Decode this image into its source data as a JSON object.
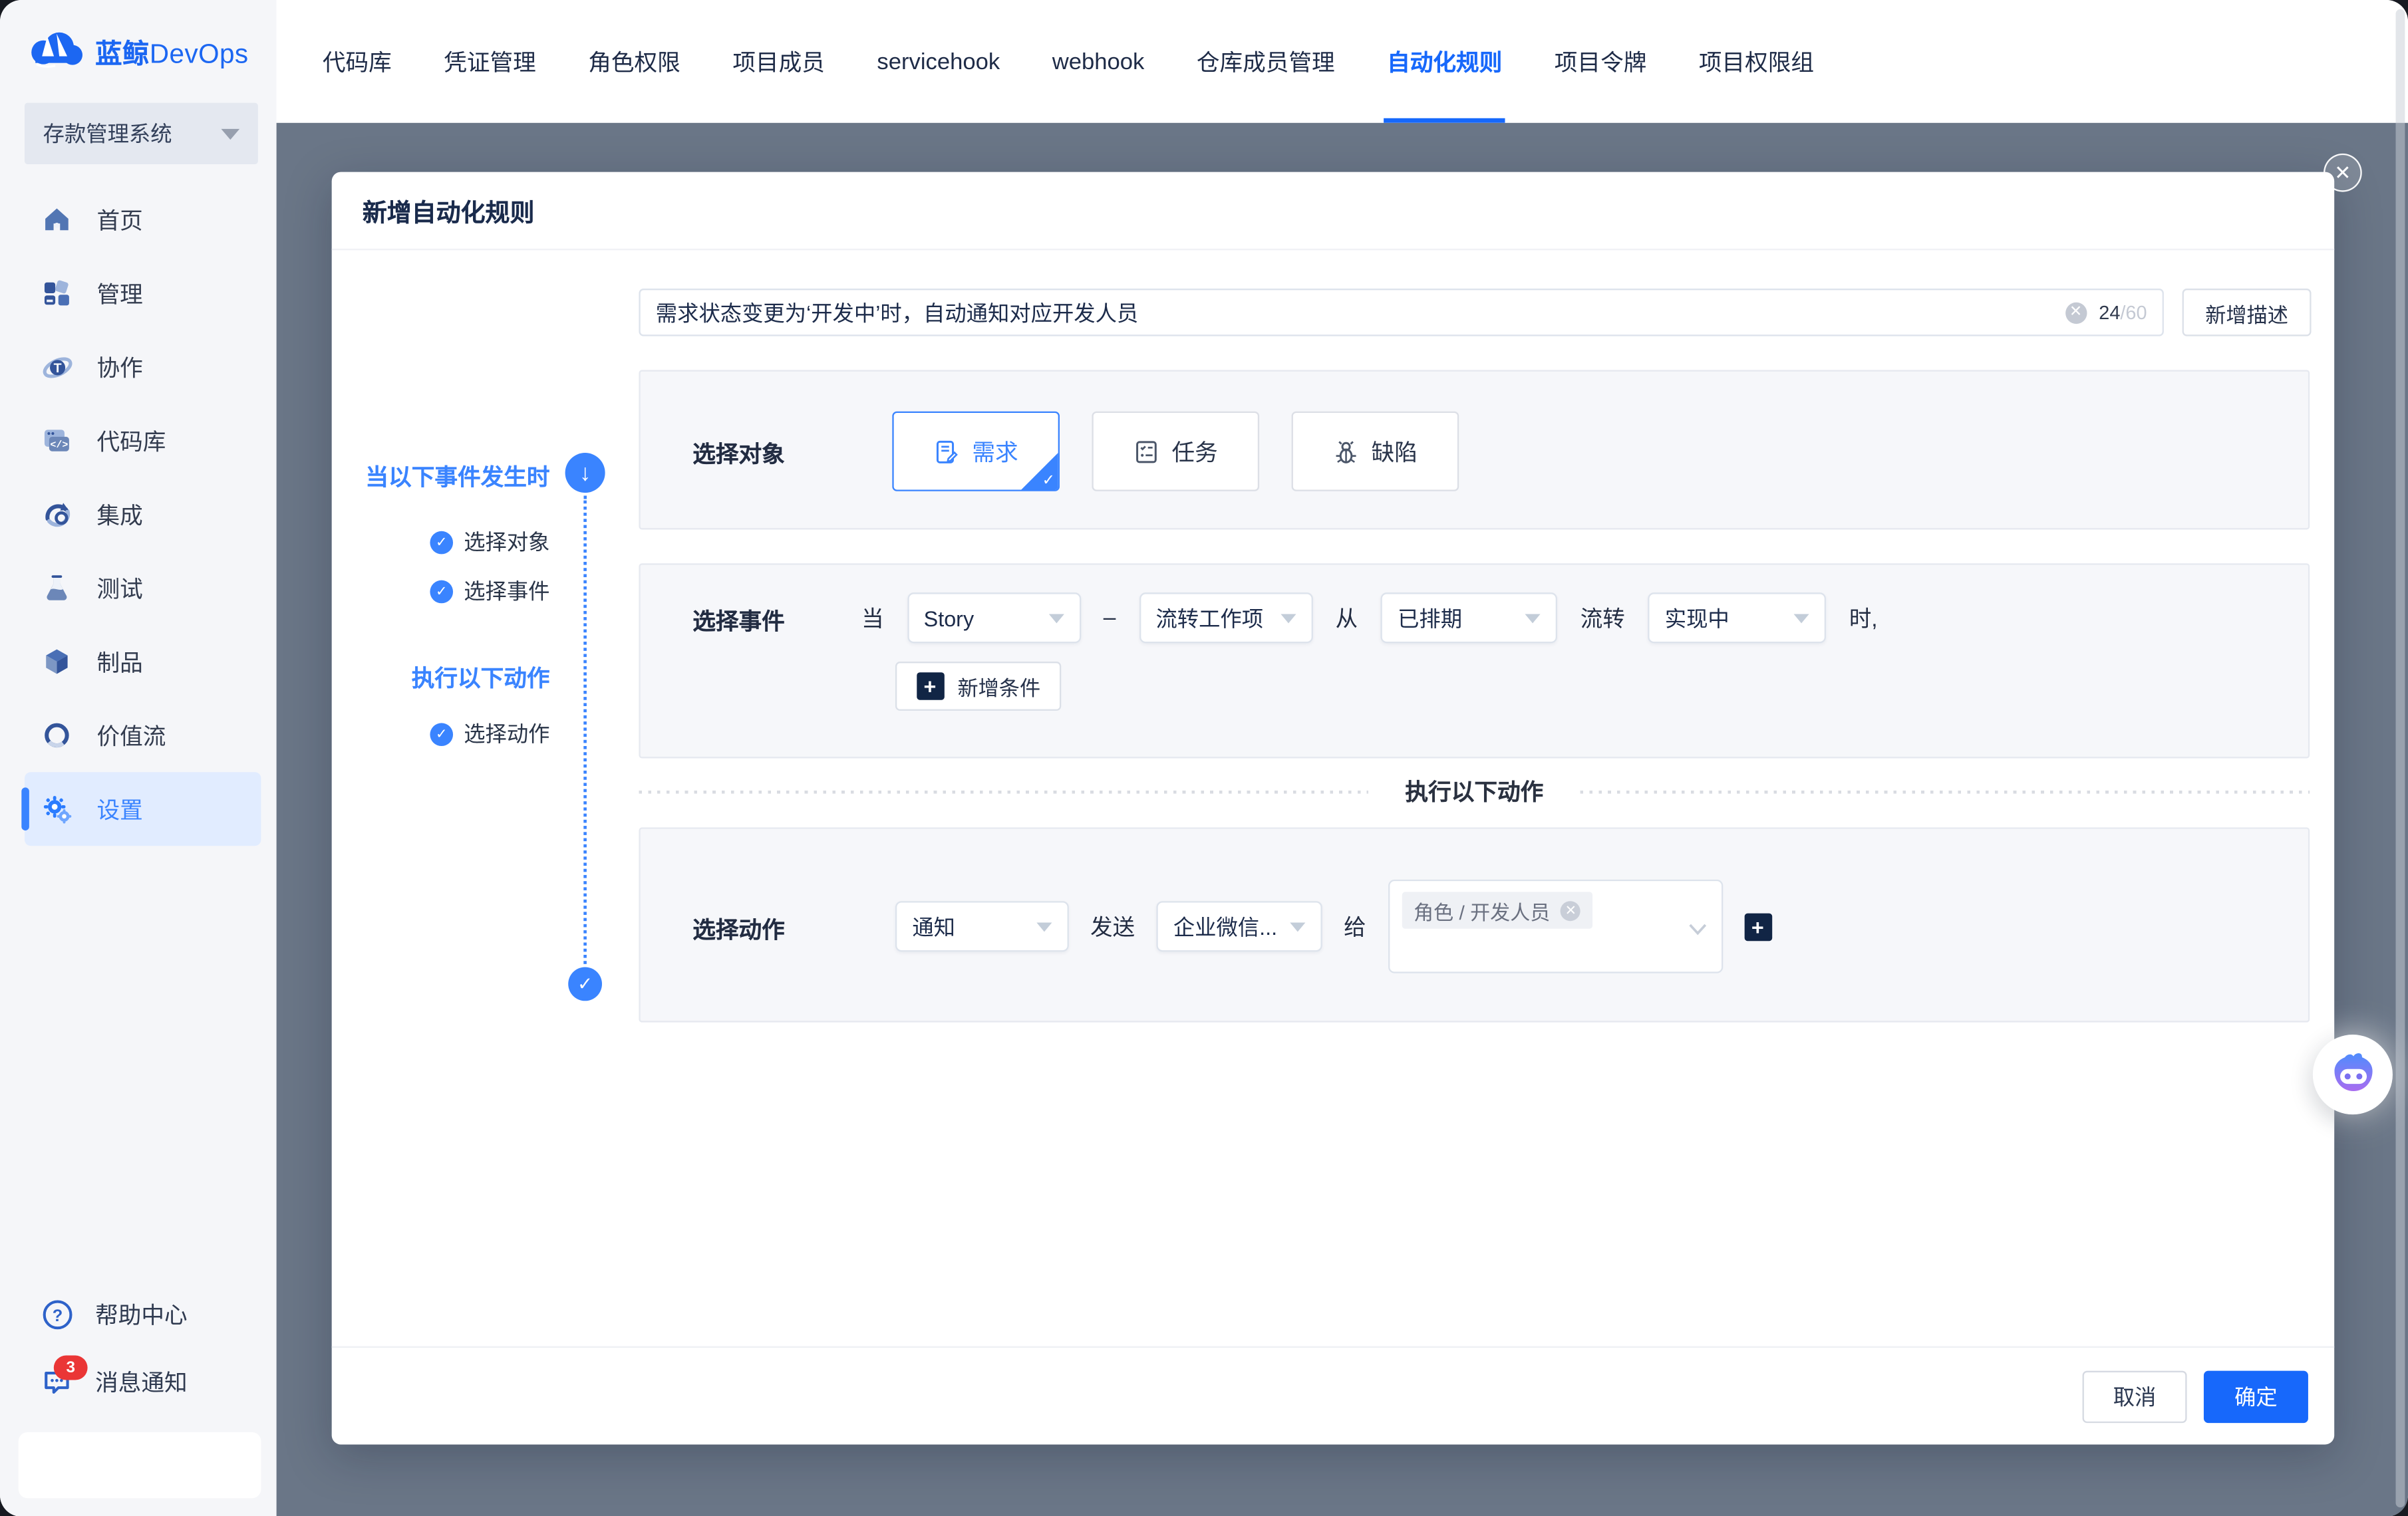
{
  "logo": {
    "brand_cn": "蓝鲸",
    "brand_en": "DevOps"
  },
  "colors": {
    "accent": "#3a84ff",
    "primary_button": "#1768fb",
    "overlay": "#6a7687",
    "badge": "#ea3636",
    "active_item_bg": "#e1ecff"
  },
  "topnav": {
    "tabs": [
      {
        "label": "代码库"
      },
      {
        "label": "凭证管理"
      },
      {
        "label": "角色权限"
      },
      {
        "label": "项目成员"
      },
      {
        "label": "servicehook"
      },
      {
        "label": "webhook"
      },
      {
        "label": "仓库成员管理"
      },
      {
        "label": "自动化规则",
        "active": true
      },
      {
        "label": "项目令牌"
      },
      {
        "label": "项目权限组"
      }
    ]
  },
  "sidebar": {
    "project_selector": {
      "label": "存款管理系统"
    },
    "items": [
      {
        "label": "首页",
        "icon": "home-icon"
      },
      {
        "label": "管理",
        "icon": "manage-icon"
      },
      {
        "label": "协作",
        "icon": "collaboration-icon"
      },
      {
        "label": "代码库",
        "icon": "repo-icon"
      },
      {
        "label": "集成",
        "icon": "integration-icon"
      },
      {
        "label": "测试",
        "icon": "test-icon"
      },
      {
        "label": "制品",
        "icon": "artifact-icon"
      },
      {
        "label": "价值流",
        "icon": "value-stream-icon"
      },
      {
        "label": "设置",
        "icon": "settings-icon",
        "active": true
      }
    ],
    "footer_items": [
      {
        "label": "帮助中心",
        "icon": "help-icon"
      },
      {
        "label": "消息通知",
        "icon": "message-icon",
        "badge": "3"
      }
    ]
  },
  "modal": {
    "title": "新增自动化规则",
    "description": {
      "value": "需求状态变更为‘开发中’时，自动通知对应开发人员",
      "count": "24",
      "max": "/60",
      "add_button": "新增描述"
    },
    "stepper": {
      "trigger_title": "当以下事件发生时",
      "steps": [
        {
          "label": "选择对象"
        },
        {
          "label": "选择事件"
        }
      ],
      "action_title": "执行以下动作",
      "action_steps": [
        {
          "label": "选择动作"
        }
      ]
    },
    "object_section": {
      "label": "选择对象",
      "options": [
        {
          "label": "需求",
          "selected": true
        },
        {
          "label": "任务"
        },
        {
          "label": "缺陷"
        }
      ]
    },
    "event_section": {
      "label": "选择事件",
      "word_when": "当",
      "select_object": "Story",
      "dash": "–",
      "select_event": "流转工作项",
      "word_from": "从",
      "select_from": "已排期",
      "word_transfer": "流转",
      "select_to": "实现中",
      "word_time": "时,",
      "add_condition": "新增条件"
    },
    "action_divider": "执行以下动作",
    "action_section": {
      "label": "选择动作",
      "select_action": "通知",
      "word_send": "发送",
      "select_channel": "企业微信...",
      "word_to": "给",
      "recipient_tag": "角色 / 开发人员"
    },
    "footer": {
      "cancel": "取消",
      "confirm": "确定"
    }
  }
}
